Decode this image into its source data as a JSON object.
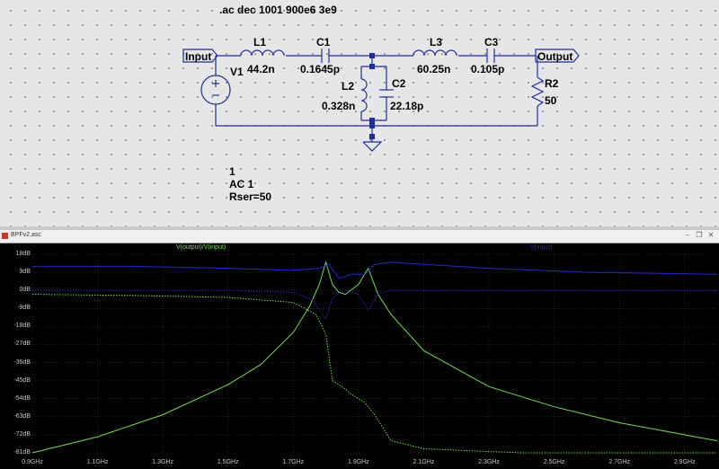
{
  "schematic": {
    "directive": ".ac dec 1001 900e6 3e9",
    "ports": {
      "input": "Input",
      "output": "Output"
    },
    "components": {
      "L1": {
        "name": "L1",
        "value": "44.2n"
      },
      "C1": {
        "name": "C1",
        "value": "0.1645p"
      },
      "L2": {
        "name": "L2",
        "value": "0.328n"
      },
      "C2": {
        "name": "C2",
        "value": "22.18p"
      },
      "L3": {
        "name": "L3",
        "value": "60.25n"
      },
      "C3": {
        "name": "C3",
        "value": "0.105p"
      },
      "R2": {
        "name": "R2",
        "value": "50"
      },
      "V1": {
        "name": "V1",
        "line1": "1",
        "line2": "AC 1",
        "line3": "Rser=50"
      }
    }
  },
  "waveform": {
    "window_title": "BPFv2.asc",
    "buttons": {
      "minimize": "–",
      "restore": "❐",
      "close": "✕"
    },
    "traces": [
      {
        "name": "V(output)/V(input)",
        "color": "#78dc50"
      },
      {
        "name": "V(input)",
        "color": "#2828c8"
      }
    ],
    "y_ticks": [
      "18dB",
      "9dB",
      "0dB",
      "-9dB",
      "-18dB",
      "-27dB",
      "-36dB",
      "-45dB",
      "-54dB",
      "-63dB",
      "-72dB",
      "-81dB"
    ],
    "x_ticks": [
      "0.9GHz",
      "1.1GHz",
      "1.3GHz",
      "1.5GHz",
      "1.7GHz",
      "1.9GHz",
      "2.1GHz",
      "2.3GHz",
      "2.5GHz",
      "2.7GHz",
      "2.9GHz"
    ]
  },
  "chart_data": {
    "type": "line",
    "x_unit": "GHz",
    "y_unit": "dB",
    "xlim": [
      0.9,
      3.0
    ],
    "ylim": [
      -81,
      18
    ],
    "series": [
      {
        "name": "V(output)/V(input)",
        "kind": "magnitude",
        "color": "#78dc50",
        "points": [
          [
            0.9,
            -81
          ],
          [
            1.1,
            -73
          ],
          [
            1.3,
            -62
          ],
          [
            1.5,
            -47
          ],
          [
            1.6,
            -37
          ],
          [
            1.7,
            -21
          ],
          [
            1.75,
            -8
          ],
          [
            1.78,
            3
          ],
          [
            1.8,
            14
          ],
          [
            1.82,
            3
          ],
          [
            1.84,
            -1
          ],
          [
            1.86,
            -2
          ],
          [
            1.9,
            3
          ],
          [
            1.93,
            11
          ],
          [
            1.96,
            -2
          ],
          [
            2.0,
            -12
          ],
          [
            2.1,
            -30
          ],
          [
            2.3,
            -48
          ],
          [
            2.5,
            -58
          ],
          [
            2.7,
            -66
          ],
          [
            2.9,
            -72
          ],
          [
            3.0,
            -75
          ]
        ]
      },
      {
        "name": "V(output)/V(input)",
        "kind": "phase",
        "color": "#78dc50",
        "points": [
          [
            0.9,
            -2
          ],
          [
            1.2,
            -2.5
          ],
          [
            1.5,
            -3.5
          ],
          [
            1.7,
            -6
          ],
          [
            1.77,
            -12
          ],
          [
            1.8,
            -22
          ],
          [
            1.82,
            -45
          ],
          [
            1.85,
            -48
          ],
          [
            1.88,
            -52
          ],
          [
            1.92,
            -56
          ],
          [
            1.95,
            -62
          ],
          [
            2.0,
            -75
          ],
          [
            2.1,
            -79
          ],
          [
            2.4,
            -81
          ],
          [
            3.0,
            -81
          ]
        ]
      },
      {
        "name": "V(input)",
        "kind": "magnitude",
        "color": "#2828c8",
        "points": [
          [
            0.9,
            12
          ],
          [
            1.2,
            12
          ],
          [
            1.5,
            11
          ],
          [
            1.7,
            10
          ],
          [
            1.78,
            11
          ],
          [
            1.81,
            13
          ],
          [
            1.84,
            6
          ],
          [
            1.88,
            8
          ],
          [
            1.92,
            8
          ],
          [
            1.95,
            13
          ],
          [
            2.0,
            14
          ],
          [
            2.3,
            11
          ],
          [
            2.6,
            9
          ],
          [
            3.0,
            8
          ]
        ]
      },
      {
        "name": "V(input)",
        "kind": "phase",
        "color": "#2828c8",
        "points": [
          [
            0.9,
            0
          ],
          [
            1.5,
            0
          ],
          [
            1.7,
            -1
          ],
          [
            1.76,
            -5
          ],
          [
            1.78,
            -10
          ],
          [
            1.8,
            -14
          ],
          [
            1.82,
            -4
          ],
          [
            1.86,
            0
          ],
          [
            1.9,
            -2
          ],
          [
            1.93,
            -10
          ],
          [
            1.96,
            -2
          ],
          [
            2.0,
            0
          ],
          [
            2.3,
            0
          ],
          [
            3.0,
            0
          ]
        ]
      }
    ]
  }
}
